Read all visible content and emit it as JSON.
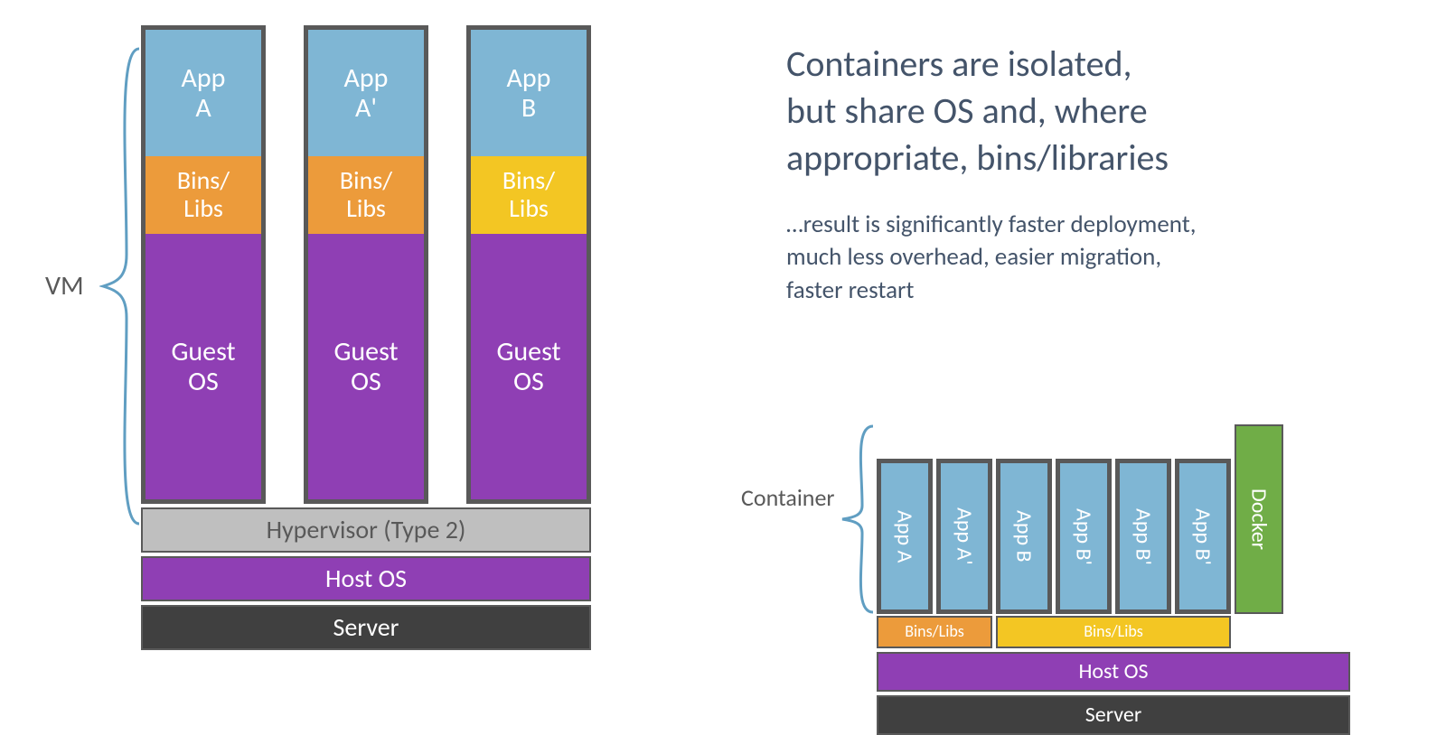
{
  "vm": {
    "label": "VM",
    "columns": [
      {
        "app": "App\nA",
        "bins": "Bins/\nLibs",
        "bins_color": "orange",
        "guest": "Guest\nOS"
      },
      {
        "app": "App\nA'",
        "bins": "Bins/\nLibs",
        "bins_color": "orange",
        "guest": "Guest\nOS"
      },
      {
        "app": "App\nB",
        "bins": "Bins/\nLibs",
        "bins_color": "yellow",
        "guest": "Guest\nOS"
      }
    ],
    "hypervisor": "Hypervisor (Type 2)",
    "host_os": "Host OS",
    "server": "Server"
  },
  "text": {
    "heading": "Containers are isolated,\nbut share OS and, where\nappropriate, bins/libraries",
    "sub": "…result is significantly faster deployment,\nmuch less overhead, easier migration,\nfaster restart"
  },
  "ctr": {
    "label": "Container",
    "apps": [
      {
        "label": "App A"
      },
      {
        "label": "App A'"
      },
      {
        "label": "App B"
      },
      {
        "label": "App B'"
      },
      {
        "label": "App B'"
      },
      {
        "label": "App B'"
      }
    ],
    "bins_left": "Bins/Libs",
    "bins_right": "Bins/Libs",
    "docker": "Docker",
    "host_os": "Host OS",
    "server": "Server"
  }
}
